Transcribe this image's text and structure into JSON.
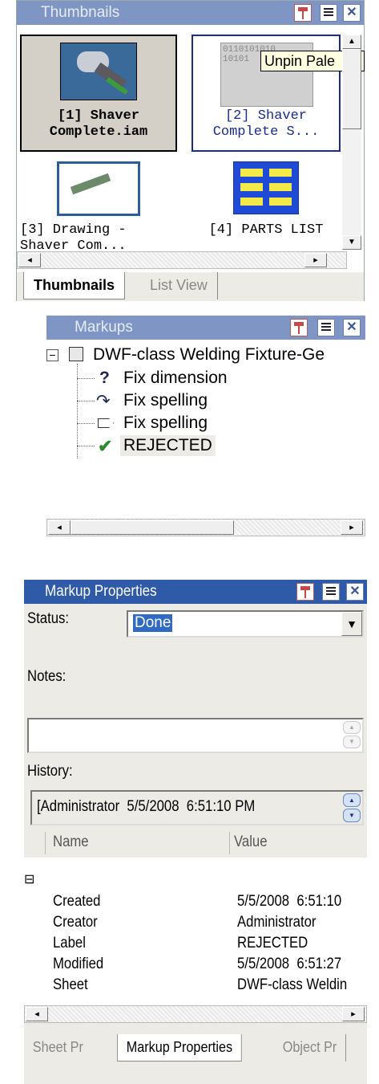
{
  "thumbnails": {
    "title": "Thumbnails",
    "tooltip": "Unpin Pale",
    "items": [
      {
        "label": "[1] Shaver Complete.iam"
      },
      {
        "label": "[2] Shaver Complete S..."
      },
      {
        "label": "[3] Drawing - Shaver Com..."
      },
      {
        "label": "[4] PARTS LIST"
      }
    ],
    "thumb_texts": {
      "binary_lines": [
        "0110101010",
        "10101",
        "0110101010"
      ]
    },
    "tabs": [
      "Thumbnails",
      "List View"
    ]
  },
  "markups": {
    "title": "Markups",
    "root": "DWF-class Welding Fixture-Ge",
    "items": [
      {
        "label": "Fix dimension",
        "icon": "question-icon"
      },
      {
        "label": "Fix spelling",
        "icon": "curved-arrow-icon"
      },
      {
        "label": "Fix spelling",
        "icon": "callout-arrow-icon"
      },
      {
        "label": "REJECTED",
        "icon": "checkmark-icon"
      }
    ]
  },
  "properties": {
    "title": "Markup Properties",
    "status_label": "Status:",
    "status_value": "Done",
    "notes_label": "Notes:",
    "notes_value": "",
    "history_label": "History:",
    "history_value": "[Administrator  5/5/2008  6:51:10 PM",
    "columns": [
      "Name",
      "Value"
    ],
    "group_toggle": "⊟",
    "rows": [
      {
        "name": "Created",
        "value": "5/5/2008  6:51:10"
      },
      {
        "name": "Creator",
        "value": "Administrator"
      },
      {
        "name": "Label",
        "value": "REJECTED"
      },
      {
        "name": "Modified",
        "value": "5/5/2008  6:51:27"
      },
      {
        "name": "Sheet",
        "value": "DWF-class Weldin"
      }
    ],
    "tabs": [
      "Sheet Pr",
      "Markup Properties",
      "Object Pr"
    ]
  },
  "colors": {
    "title_active": "#2f5aa8",
    "title_inactive": "#7f96c4",
    "selection": "#316ac5"
  }
}
